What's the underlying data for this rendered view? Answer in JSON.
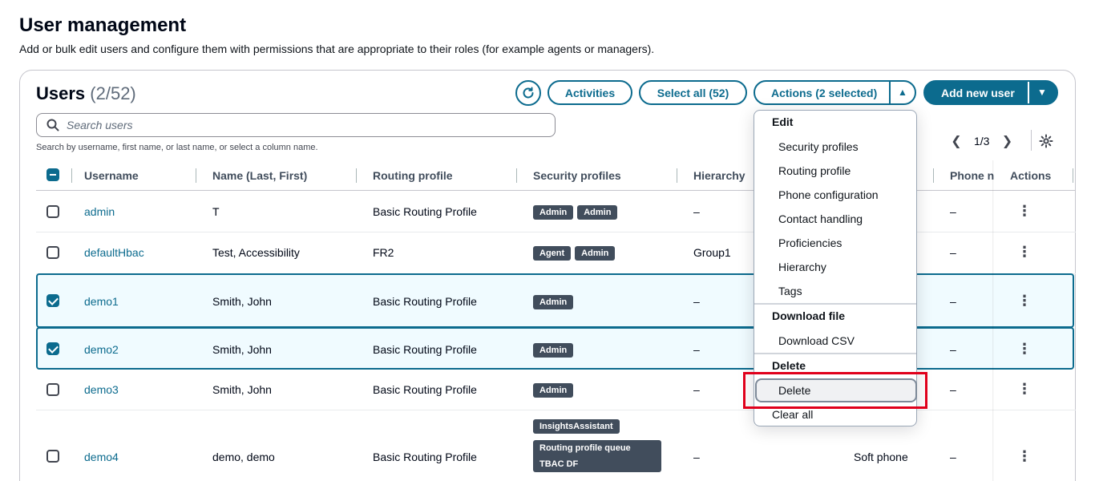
{
  "page": {
    "title": "User management",
    "description": "Add or bulk edit users and configure them with permissions that are appropriate to their roles (for example agents or managers)."
  },
  "users_panel": {
    "title": "Users",
    "count": "(2/52)",
    "toolbar": {
      "refresh_icon": "refresh-icon",
      "activities": "Activities",
      "select_all": "Select all (52)",
      "actions": "Actions (2 selected)",
      "add_new_user": "Add new user"
    },
    "search": {
      "placeholder": "Search users",
      "hint": "Search by username, first name, or last name, or select a column name."
    },
    "pagination": {
      "current": "1/3"
    }
  },
  "table": {
    "columns": [
      "Username",
      "Name (Last, First)",
      "Routing profile",
      "Security profiles",
      "Hierarchy",
      "Phone n",
      "Actions"
    ],
    "rows": [
      {
        "username": "admin",
        "name": "T",
        "routing": "Basic Routing Profile",
        "security": [
          "Admin",
          "Admin"
        ],
        "hierarchy": "–",
        "phone_type": "",
        "phone": "–",
        "selected": false
      },
      {
        "username": "defaultHbac",
        "name": "Test, Accessibility",
        "routing": "FR2",
        "security": [
          "Agent",
          "Admin"
        ],
        "hierarchy": "Group1",
        "phone_type": "",
        "phone": "–",
        "selected": false
      },
      {
        "username": "demo1",
        "name": "Smith, John",
        "routing": "Basic Routing Profile",
        "security": [
          "Admin"
        ],
        "hierarchy": "–",
        "phone_type": "",
        "phone": "–",
        "selected": true
      },
      {
        "username": "demo2",
        "name": "Smith, John",
        "routing": "Basic Routing Profile",
        "security": [
          "Admin"
        ],
        "hierarchy": "–",
        "phone_type": "",
        "phone": "–",
        "selected": true
      },
      {
        "username": "demo3",
        "name": "Smith, John",
        "routing": "Basic Routing Profile",
        "security": [
          "Admin"
        ],
        "hierarchy": "–",
        "phone_type": "",
        "phone": "–",
        "selected": false
      },
      {
        "username": "demo4",
        "name": "demo, demo",
        "routing": "Basic Routing Profile",
        "security": [
          "InsightsAssistant",
          "Routing profile queue TBAC DF"
        ],
        "hierarchy": "–",
        "phone_type": "Soft phone",
        "phone": "–",
        "selected": false
      }
    ]
  },
  "actions_menu": {
    "groups": [
      {
        "label": "Edit",
        "items": [
          "Security profiles",
          "Routing profile",
          "Phone configuration",
          "Contact handling",
          "Proficiencies",
          "Hierarchy",
          "Tags"
        ]
      },
      {
        "label": "Download file",
        "items": [
          "Download CSV"
        ]
      },
      {
        "label": "Delete",
        "items": [
          "Delete"
        ]
      }
    ],
    "clear_all": "Clear all",
    "highlighted_item": "Delete"
  },
  "colors": {
    "accent": "#0c6b8e",
    "badge": "#414d5c",
    "highlight_outline": "#e0001b"
  }
}
